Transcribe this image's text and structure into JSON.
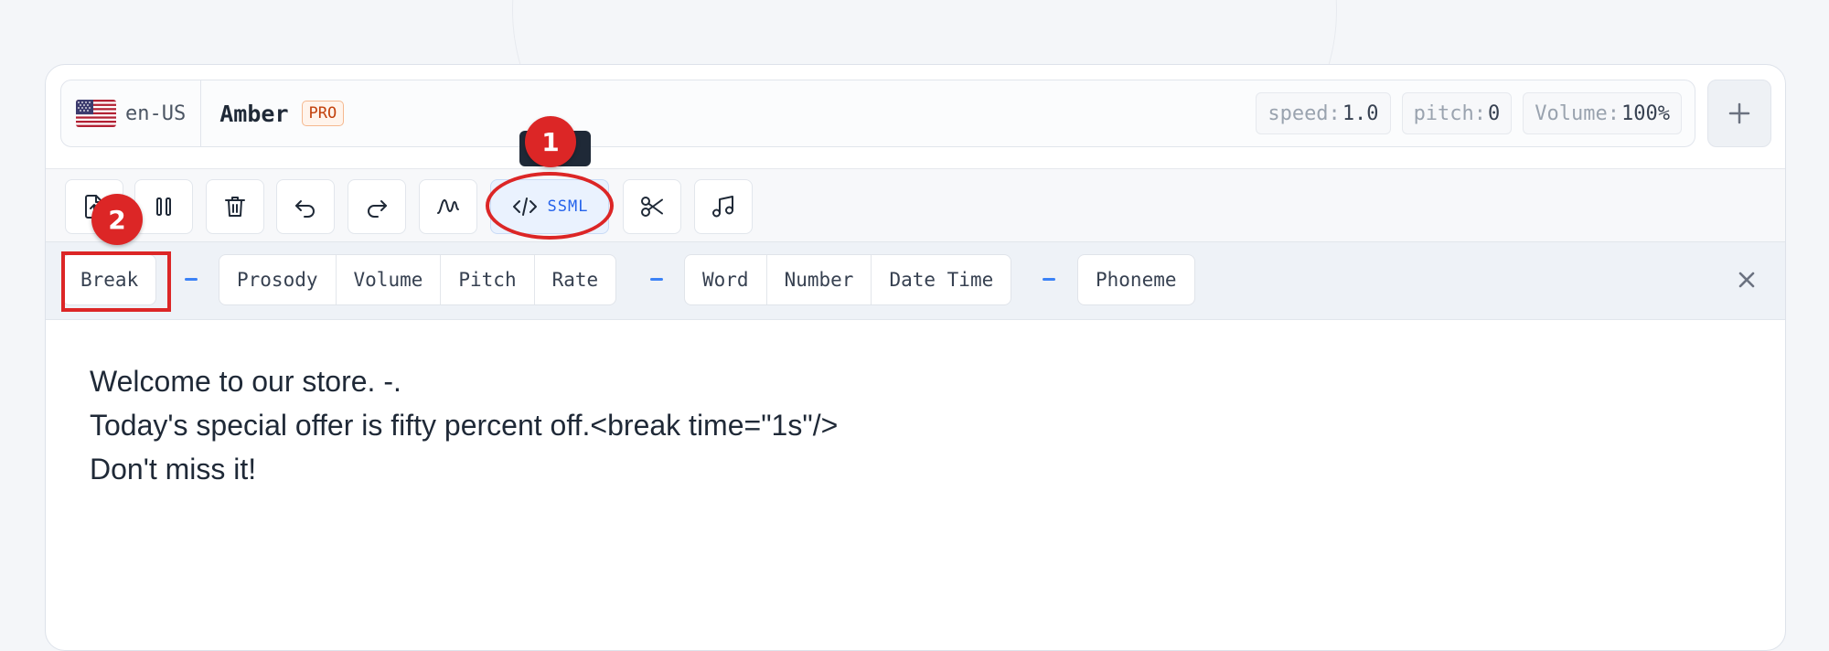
{
  "voice": {
    "locale": "en-US",
    "name": "Amber",
    "tier_badge": "PRO",
    "params": [
      {
        "label": "speed:",
        "value": "1.0"
      },
      {
        "label": "pitch:",
        "value": "0"
      },
      {
        "label": "Volume:",
        "value": "100%"
      }
    ]
  },
  "toolbar": {
    "ssml_label": "SSML"
  },
  "ssml_tags": {
    "group1": [
      "Break"
    ],
    "group2": [
      "Prosody",
      "Volume",
      "Pitch",
      "Rate"
    ],
    "group3": [
      "Word",
      "Number",
      "Date Time"
    ],
    "group4": [
      "Phoneme"
    ]
  },
  "editor": {
    "lines": [
      "Welcome to our store. -.",
      "Today's special offer is fifty percent off.<break time=\"1s\"/>",
      "Don't miss it!"
    ]
  },
  "annotations": {
    "step1": "1",
    "step2": "2"
  },
  "colors": {
    "accent": "#2563eb",
    "annotation": "#dc2626",
    "pro": "#c2410c"
  }
}
